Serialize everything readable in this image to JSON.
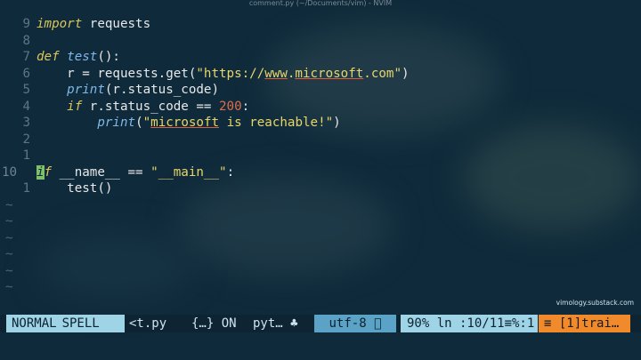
{
  "window": {
    "title": "comment.py (~/Documents/vim) - NVIM"
  },
  "editor": {
    "lines": [
      {
        "num": "9",
        "parts": [
          {
            "t": "import",
            "c": "kw"
          },
          {
            "t": " requests",
            "c": ""
          }
        ]
      },
      {
        "num": "8",
        "parts": []
      },
      {
        "num": "7",
        "parts": [
          {
            "t": "def",
            "c": "kw"
          },
          {
            "t": " ",
            "c": ""
          },
          {
            "t": "test",
            "c": "fn"
          },
          {
            "t": "():",
            "c": ""
          }
        ]
      },
      {
        "num": "6",
        "parts": [
          {
            "t": "    r = requests.get(",
            "c": ""
          },
          {
            "t": "\"https://",
            "c": "str"
          },
          {
            "t": "www",
            "c": "str under"
          },
          {
            "t": ".",
            "c": "str"
          },
          {
            "t": "microsoft",
            "c": "str under"
          },
          {
            "t": ".com\"",
            "c": "str"
          },
          {
            "t": ")",
            "c": ""
          }
        ]
      },
      {
        "num": "5",
        "parts": [
          {
            "t": "    ",
            "c": ""
          },
          {
            "t": "print",
            "c": "fn"
          },
          {
            "t": "(r.status_code)",
            "c": ""
          }
        ]
      },
      {
        "num": "4",
        "parts": [
          {
            "t": "    ",
            "c": ""
          },
          {
            "t": "if",
            "c": "kw"
          },
          {
            "t": " r.status_code == ",
            "c": ""
          },
          {
            "t": "200",
            "c": "num"
          },
          {
            "t": ":",
            "c": ""
          }
        ]
      },
      {
        "num": "3",
        "parts": [
          {
            "t": "        ",
            "c": ""
          },
          {
            "t": "print",
            "c": "fn"
          },
          {
            "t": "(",
            "c": ""
          },
          {
            "t": "\"",
            "c": "str"
          },
          {
            "t": "microsoft",
            "c": "str under"
          },
          {
            "t": " is reachable!\"",
            "c": "str"
          },
          {
            "t": ")",
            "c": ""
          }
        ]
      },
      {
        "num": "2",
        "parts": []
      },
      {
        "num": "1",
        "parts": []
      },
      {
        "num": "10",
        "current": true,
        "parts": [
          {
            "t": "i",
            "c": "kw cursor"
          },
          {
            "t": "f",
            "c": "kw"
          },
          {
            "t": " __name__ == ",
            "c": ""
          },
          {
            "t": "\"__main__\"",
            "c": "str"
          },
          {
            "t": ":",
            "c": ""
          }
        ]
      },
      {
        "num": "1",
        "parts": [
          {
            "t": "    test()",
            "c": ""
          }
        ]
      }
    ],
    "tilde_count": 6,
    "tilde_char": "~"
  },
  "watermark": "vimology.substack.com",
  "statusline": {
    "mode": "NORMAL",
    "spell": "SPELL",
    "file": "<t.py",
    "plugin": "{…} ON",
    "filetype": "pyt… ♣",
    "encoding": "utf-8 ",
    "position": "90% ln :10/11≡%:1",
    "trailing": "≡ [1]trai…"
  },
  "colors": {
    "background": "#0f2a3a",
    "keyword": "#d9c55a",
    "function": "#7fb7e8",
    "string": "#e8d66a",
    "number": "#e06c4c",
    "mode_bg": "#9fd4e7",
    "encoding_bg": "#5aa3c7",
    "trailing_bg": "#f08a2a"
  }
}
